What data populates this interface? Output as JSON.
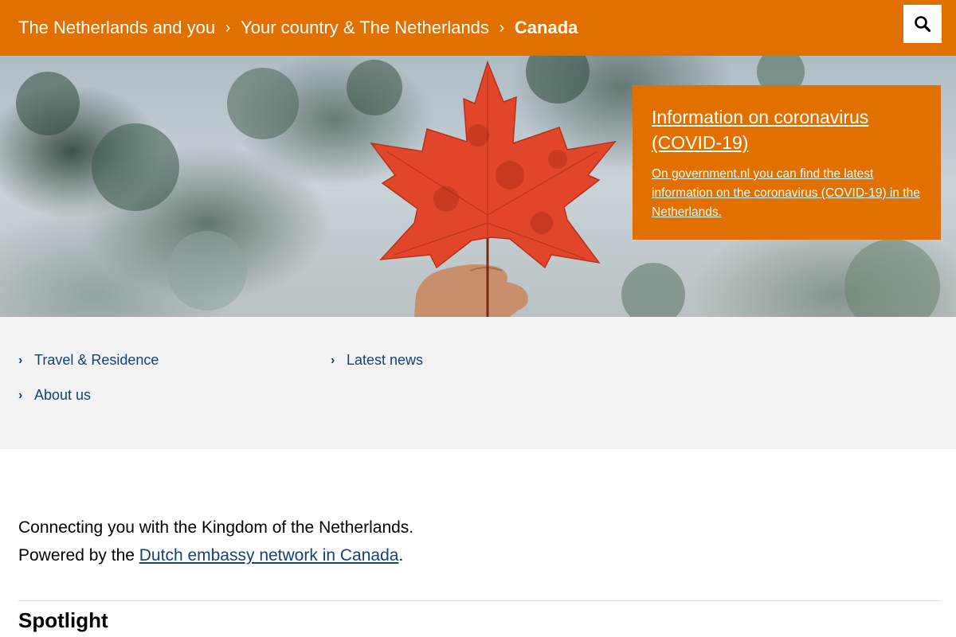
{
  "breadcrumb": {
    "items": [
      "The Netherlands and you",
      "Your country & The Netherlands"
    ],
    "current": "Canada",
    "separator": "›"
  },
  "search": {
    "icon": "search-icon"
  },
  "hero": {
    "image": "red-maple-leaf-held-up-against-trees"
  },
  "covid": {
    "title": "Information on coronavirus (COVID-19)",
    "text": "On government.nl you can find the latest information on the coronavirus (COVID-19) in the Netherlands."
  },
  "links": {
    "travel": "Travel & Residence",
    "about": "About us",
    "news": "Latest news"
  },
  "intro": {
    "line1": "Connecting you with the Kingdom of the Netherlands.",
    "line2_prefix": "Powered by the ",
    "line2_link": "Dutch embassy network in Canada",
    "line2_suffix": "."
  },
  "spotlight": {
    "title": "Spotlight"
  },
  "colors": {
    "brand_orange": "#e17000",
    "link_blue": "#154273",
    "band_grey": "#f3f3f3"
  }
}
